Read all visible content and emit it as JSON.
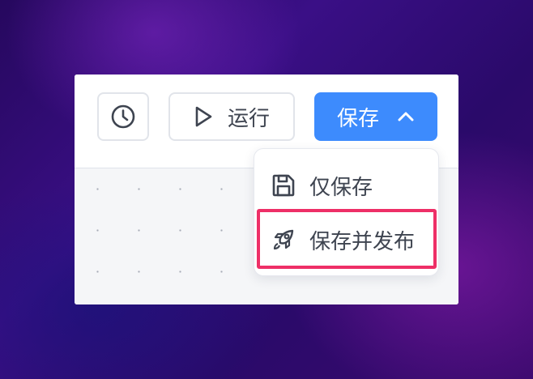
{
  "toolbar": {
    "history_icon": "clock-icon",
    "run_label": "运行",
    "run_icon": "play-icon",
    "save_label": "保存",
    "save_icon": "chevron-up-icon"
  },
  "dropdown": {
    "items": [
      {
        "label": "仅保存",
        "icon": "floppy-disk-icon"
      },
      {
        "label": "保存并发布",
        "icon": "rocket-icon",
        "highlighted": true
      }
    ]
  },
  "colors": {
    "primary": "#3d8bfd",
    "highlight": "#ee2f67",
    "text": "#3e4450"
  }
}
